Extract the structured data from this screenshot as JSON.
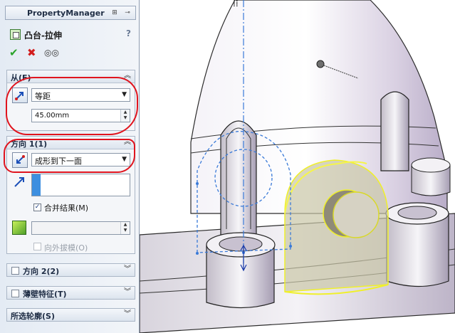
{
  "property_manager": {
    "title": "PropertyManager",
    "feature_title": "凸台-拉伸",
    "help": "?",
    "ok_glyph": "✔",
    "cancel_glyph": "✖",
    "preview_glyph": "◎◎"
  },
  "from_group": {
    "title": "从(F)",
    "type_value": "等距",
    "offset_value": "45.00mm"
  },
  "direction1": {
    "title": "方向 1(1)",
    "end_condition": "成形到下一面",
    "merge_label": "合并结果(M)",
    "merge_checked": true,
    "draft_label": "向外拔模(O)",
    "draft_checked": false
  },
  "direction2": {
    "title": "方向 2(2)"
  },
  "thin_feature": {
    "title": "薄壁特征(T)"
  },
  "selected_contours": {
    "title": "所选轮廓(S)"
  },
  "colors": {
    "highlight": "#e0141e",
    "preview": "#f0f02a",
    "sketch": "#3a7ad8"
  }
}
